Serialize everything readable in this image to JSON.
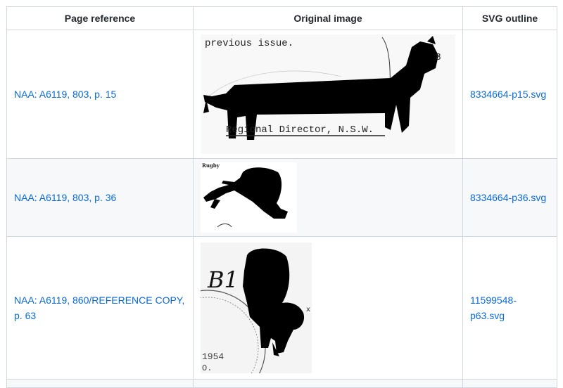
{
  "table": {
    "headers": {
      "page_reference": "Page reference",
      "original_image": "Original image",
      "svg_outline": "SVG outline"
    },
    "rows": [
      {
        "page_reference": "NAA: A6119, 803, p. 15",
        "svg_outline": "8334664-p15.svg",
        "image_text": [
          "previous issue.",
          "Regional Director, N.S.W."
        ]
      },
      {
        "page_reference": "NAA: A6119, 803, p. 36",
        "svg_outline": "8334664-p36.svg",
        "image_text": [
          "Rugby"
        ]
      },
      {
        "page_reference": "NAA: A6119, 860/REFERENCE COPY, p. 63",
        "svg_outline": "11599548-p63.svg",
        "image_text": [
          "B1",
          "1954",
          "O."
        ]
      }
    ]
  },
  "colors": {
    "link": "#0969da",
    "border": "#d0d7de",
    "alt_row": "#f6f8fa",
    "silhouette": "#000000"
  }
}
